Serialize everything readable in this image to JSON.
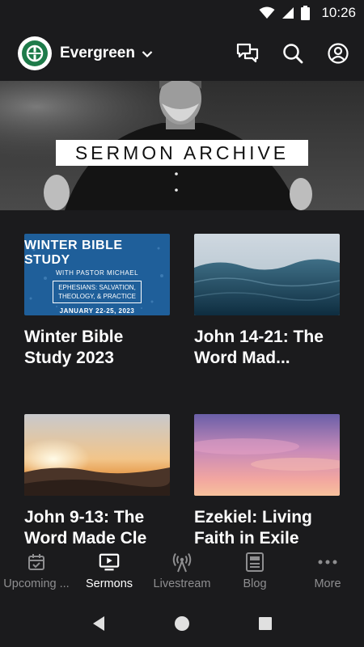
{
  "status_bar": {
    "time": "10:26"
  },
  "app_bar": {
    "church_name": "Evergreen"
  },
  "hero": {
    "title": "SERMON ARCHIVE"
  },
  "cards": [
    {
      "title": "Winter Bible Study 2023",
      "thumb_text": {
        "heading": "WINTER BIBLE STUDY",
        "subheading": "WITH PASTOR MICHAEL",
        "box_line1": "EPHESIANS: SALVATION,",
        "box_line2": "THEOLOGY, & PRACTICE",
        "dates": "JANUARY 22-25, 2023"
      }
    },
    {
      "title": "John 14-21: The Word Mad..."
    },
    {
      "title": "John 9-13: The Word Made Cle"
    },
    {
      "title": "Ezekiel: Living Faith in Exile"
    }
  ],
  "bottom_nav": [
    {
      "label": "Upcoming ...",
      "icon": "calendar-check-icon"
    },
    {
      "label": "Sermons",
      "icon": "tv-play-icon",
      "active": true
    },
    {
      "label": "Livestream",
      "icon": "broadcast-icon"
    },
    {
      "label": "Blog",
      "icon": "article-icon"
    },
    {
      "label": "More",
      "icon": "more-horizontal-icon"
    }
  ],
  "colors": {
    "background": "#1b1b1d",
    "active": "#ffffff",
    "inactive": "#8e8e90",
    "brand_green": "#1e7b4a"
  }
}
